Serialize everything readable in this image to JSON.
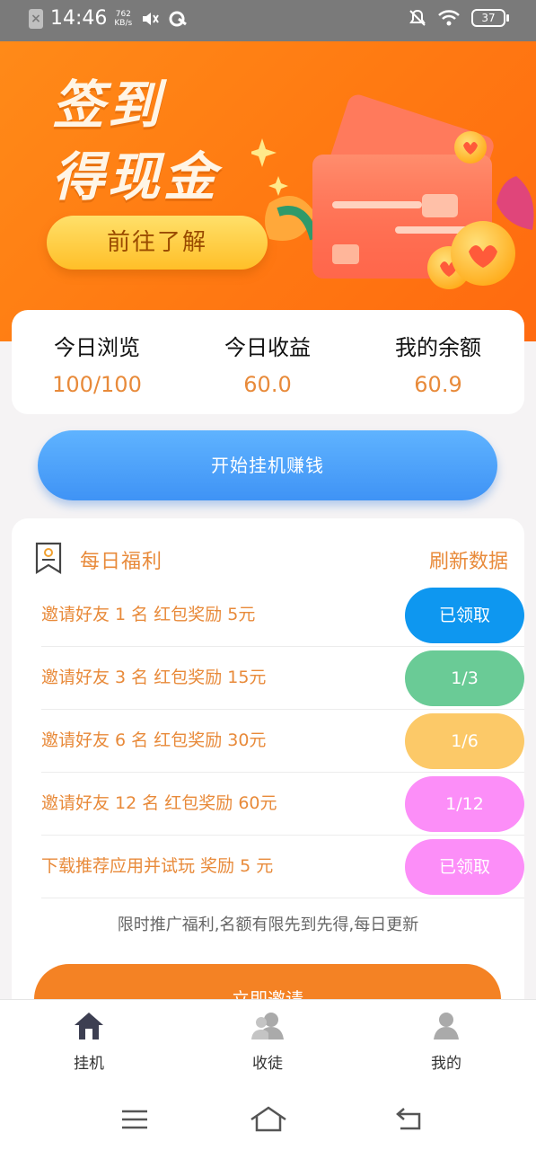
{
  "status_bar": {
    "time": "14:46",
    "net_speed_value": "762",
    "net_speed_unit": "KB/s",
    "battery": "37"
  },
  "banner": {
    "title_line1": "签到",
    "title_line2": "得现金",
    "button_label": "前往了解"
  },
  "stats": [
    {
      "label": "今日浏览",
      "value": "100/100"
    },
    {
      "label": "今日收益",
      "value": "60.0"
    },
    {
      "label": "我的余额",
      "value": "60.9"
    }
  ],
  "start_button": "开始挂机赚钱",
  "welfare": {
    "title": "每日福利",
    "refresh": "刷新数据",
    "rows": [
      {
        "text": "邀请好友 1 名 红包奖励 5元",
        "status": "已领取",
        "color": "#0e97f0"
      },
      {
        "text": "邀请好友 3 名 红包奖励 15元",
        "status": "1/3",
        "color": "#6acb96"
      },
      {
        "text": "邀请好友 6 名 红包奖励 30元",
        "status": "1/6",
        "color": "#fcc968"
      },
      {
        "text": "邀请好友 12 名 红包奖励 60元",
        "status": "1/12",
        "color": "#fc8ef8"
      },
      {
        "text": "下载推荐应用并试玩 奖励 5 元",
        "status": "已领取",
        "color": "#fc8ef8"
      }
    ],
    "note": "限时推广福利,名额有限先到先得,每日更新",
    "invite_button": "立即邀请"
  },
  "bottom_nav": [
    {
      "label": "挂机",
      "icon": "home-icon",
      "active": true
    },
    {
      "label": "收徒",
      "icon": "users-icon",
      "active": false
    },
    {
      "label": "我的",
      "icon": "person-icon",
      "active": false
    }
  ],
  "colors": {
    "accent_orange": "#e88a3a",
    "banner_orange": "#ff7a12",
    "start_blue": "#4aa2fb",
    "invite_orange": "#f48224"
  }
}
